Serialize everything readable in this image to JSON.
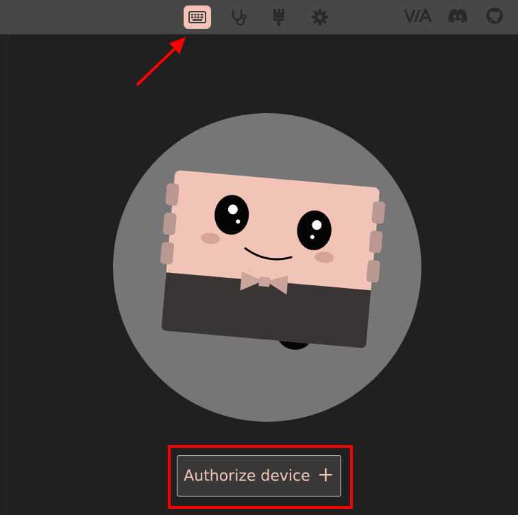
{
  "app": {
    "name": "VIA"
  },
  "topbar": {
    "nav": [
      {
        "id": "configure",
        "icon": "keyboard-icon",
        "active": true
      },
      {
        "id": "test",
        "icon": "stethoscope-icon",
        "active": false
      },
      {
        "id": "design",
        "icon": "paintbrush-icon",
        "active": false
      },
      {
        "id": "settings",
        "icon": "gear-icon",
        "active": false
      }
    ],
    "links": [
      {
        "id": "via-logo",
        "icon": "via-logo-icon",
        "text": "V/A"
      },
      {
        "id": "discord",
        "icon": "discord-icon"
      },
      {
        "id": "github",
        "icon": "github-icon"
      }
    ]
  },
  "hero": {
    "illustration": "keyboard-mascot"
  },
  "main": {
    "authorize_label": "Authorize device",
    "authorize_icon": "plus-icon",
    "authorize_plus": "+"
  },
  "annotations": {
    "arrow_color": "#ff0000",
    "highlight_color": "#ff0000"
  },
  "colors": {
    "accent": "#f1c4b7",
    "topbar": "#474747",
    "background": "#202020",
    "icon_inactive": "#2a2a2a"
  }
}
